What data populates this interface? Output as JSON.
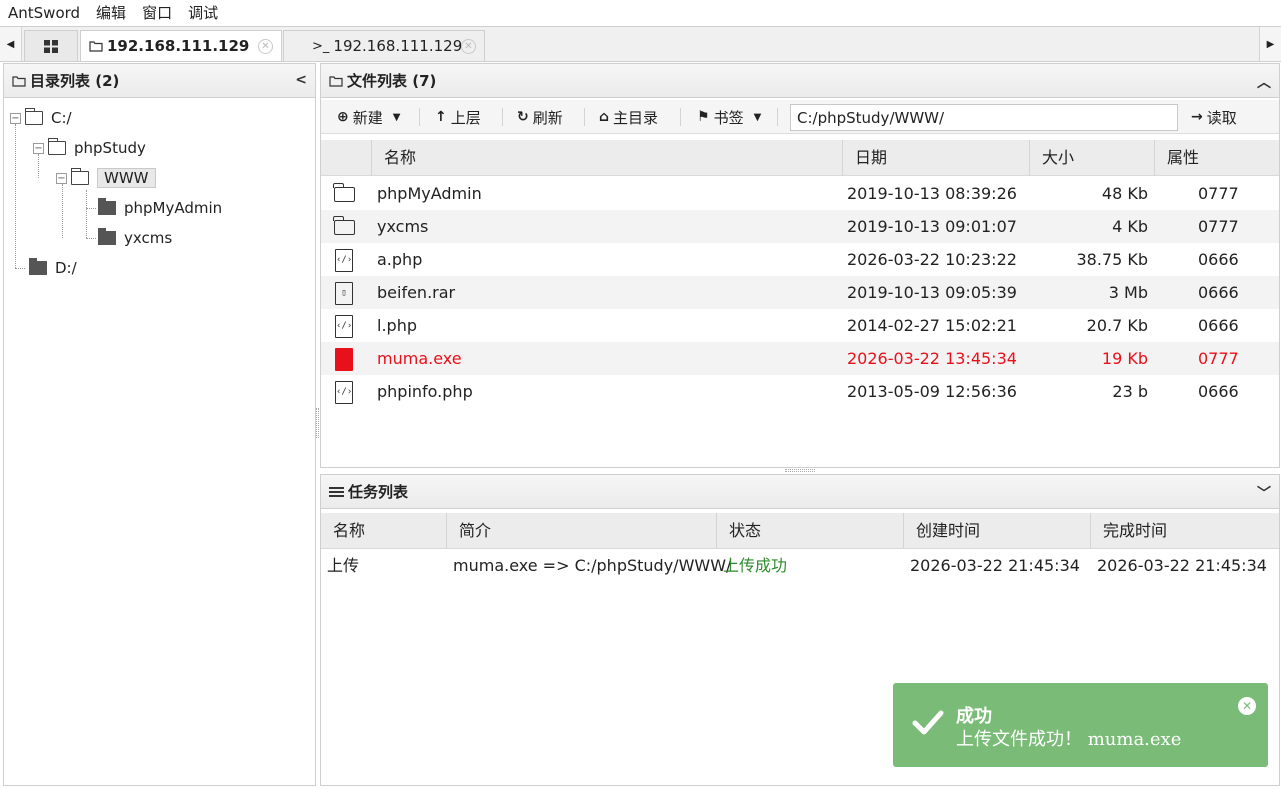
{
  "menubar": {
    "items": [
      "AntSword",
      "编辑",
      "窗口",
      "调试"
    ]
  },
  "tabs": {
    "active": "192.168.111.129",
    "shell": "192.168.111.129",
    "shell_prefix": ">_"
  },
  "dirpane": {
    "title": "目录列表 (2)",
    "nodes": [
      "C:/",
      "phpStudy",
      "WWW",
      "phpMyAdmin",
      "yxcms",
      "D:/"
    ]
  },
  "filepane": {
    "title": "文件列表 (7)",
    "toolbar": {
      "new": "新建",
      "up": "上层",
      "refresh": "刷新",
      "home": "主目录",
      "bookmark": "书签",
      "path": "C:/phpStudy/WWW/",
      "read": "读取"
    },
    "columns": [
      "名称",
      "日期",
      "大小",
      "属性"
    ],
    "rows": [
      {
        "name": "phpMyAdmin",
        "date": "2019-10-13 08:39:26",
        "size": "48 Kb",
        "attr": "0777",
        "icon": "folder-icon"
      },
      {
        "name": "yxcms",
        "date": "2019-10-13 09:01:07",
        "size": "4 Kb",
        "attr": "0777",
        "icon": "folder-icon"
      },
      {
        "name": "a.php",
        "date": "2026-03-22 10:23:22",
        "size": "38.75 Kb",
        "attr": "0666",
        "icon": "code-file-icon"
      },
      {
        "name": "beifen.rar",
        "date": "2019-10-13 09:05:39",
        "size": "3 Mb",
        "attr": "0666",
        "icon": "archive-file-icon"
      },
      {
        "name": "l.php",
        "date": "2014-02-27 15:02:21",
        "size": "20.7 Kb",
        "attr": "0666",
        "icon": "code-file-icon"
      },
      {
        "name": "muma.exe",
        "date": "2026-03-22 13:45:34",
        "size": "19 Kb",
        "attr": "0777",
        "icon": "file-icon"
      },
      {
        "name": "phpinfo.php",
        "date": "2013-05-09 12:56:36",
        "size": "23 b",
        "attr": "0666",
        "icon": "code-file-icon"
      }
    ],
    "highlight_color": "#e8101a"
  },
  "taskpane": {
    "title": "任务列表",
    "columns": [
      "名称",
      "简介",
      "状态",
      "创建时间",
      "完成时间"
    ],
    "rows": [
      {
        "name": "上传",
        "desc": "muma.exe => C:/phpStudy/WWW/",
        "status": "上传成功",
        "created": "2026-03-22 21:45:34",
        "finished": "2026-03-22 21:45:34"
      }
    ],
    "status_color": "#2e8b2e"
  },
  "toast": {
    "title": "成功",
    "message": "上传文件成功！ muma.exe",
    "color": "#7abc77"
  }
}
